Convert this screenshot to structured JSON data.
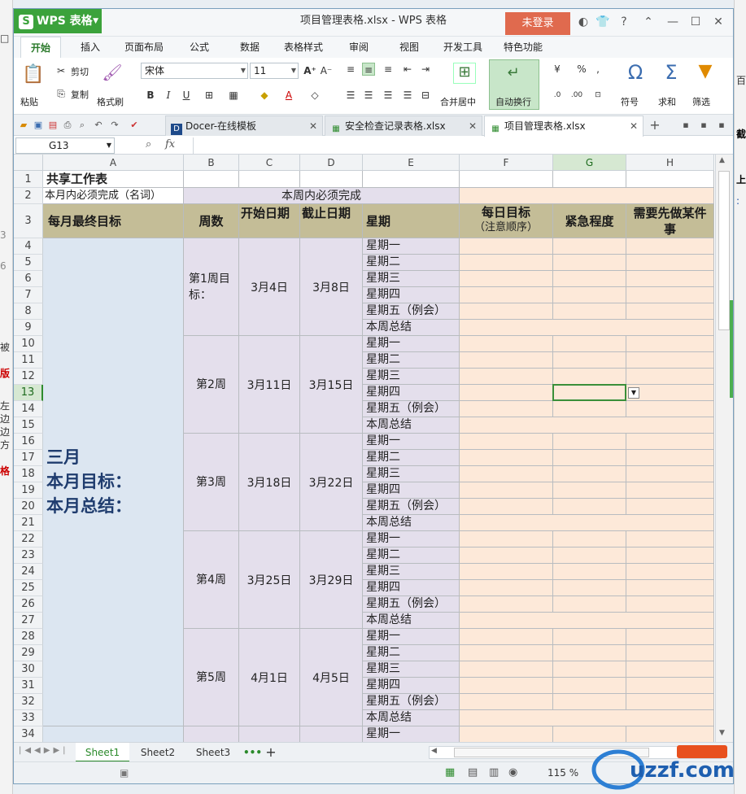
{
  "app": {
    "name": "WPS 表格",
    "window_title": "项目管理表格.xlsx - WPS 表格",
    "login_label": "未登录"
  },
  "menu": [
    "开始",
    "插入",
    "页面布局",
    "公式",
    "数据",
    "表格样式",
    "审阅",
    "视图",
    "开发工具",
    "特色功能"
  ],
  "ribbon": {
    "paste": "粘贴",
    "cut": "剪切",
    "copy": "复制",
    "format_painter": "格式刷",
    "font_name": "宋体",
    "font_size": "11",
    "merge_center": "合并居中",
    "wrap_text": "自动换行",
    "percent": "%",
    "comma": ",",
    "symbol": "符号",
    "sum": "求和",
    "filter": "筛选"
  },
  "doc_tabs": [
    {
      "label": "Docer-在线模板",
      "active": false
    },
    {
      "label": "安全检查记录表格.xlsx",
      "active": false
    },
    {
      "label": "项目管理表格.xlsx",
      "active": true
    }
  ],
  "formula_bar": {
    "cell_ref": "G13",
    "fx": "fx"
  },
  "columns": [
    "A",
    "B",
    "C",
    "D",
    "E",
    "F",
    "G",
    "H"
  ],
  "rows": [
    "1",
    "2",
    "3",
    "4",
    "5",
    "6",
    "7",
    "8",
    "9",
    "10",
    "11",
    "12",
    "13",
    "14",
    "15",
    "16",
    "17",
    "18",
    "19",
    "20",
    "21",
    "22",
    "23",
    "24",
    "25",
    "26",
    "27",
    "28",
    "29",
    "30",
    "31",
    "32",
    "33",
    "34"
  ],
  "sheet": {
    "a1": "共享工作表",
    "a2": "本月内必须完成（名词）",
    "b2": "本周内必须完成",
    "headers": {
      "a": "每月最终目标",
      "b": "周数",
      "c": "开始日期",
      "d": "截止日期",
      "e": "星期",
      "f1": "每日目标",
      "f2": "（注意顺序）",
      "g": "紧急程度",
      "h": "需要先做某件事"
    },
    "month_line1": "三月",
    "month_line2": "本月目标：",
    "month_line3": "本月总结：",
    "weeks": [
      {
        "label": "第1周目标：",
        "start": "3月4日",
        "end": "3月8日"
      },
      {
        "label": "第2周",
        "start": "3月11日",
        "end": "3月15日"
      },
      {
        "label": "第3周",
        "start": "3月18日",
        "end": "3月22日"
      },
      {
        "label": "第4周",
        "start": "3月25日",
        "end": "3月29日"
      },
      {
        "label": "第5周",
        "start": "4月1日",
        "end": "4月5日"
      }
    ],
    "days": [
      "星期一",
      "星期二",
      "星期三",
      "星期四",
      "星期五（例会）",
      "本周总结"
    ],
    "row34_day": "星期一"
  },
  "sheet_tabs": [
    "Sheet1",
    "Sheet2",
    "Sheet3"
  ],
  "status": {
    "zoom": "115 %"
  },
  "watermark": "uzzf.com",
  "colors": {
    "lavender": "#e4dfec",
    "tan": "#c4bd97",
    "peach": "#fde9d9",
    "light_blue": "#dce6f1",
    "wps_green": "#3ba23b",
    "login_red": "#e06a4e",
    "month_text": "#1f3c6e"
  }
}
